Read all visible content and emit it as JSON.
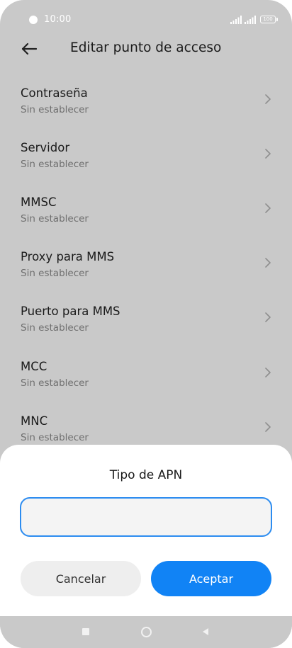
{
  "status_bar": {
    "time": "10:00",
    "battery": "100"
  },
  "header": {
    "back_icon": "arrow-left-icon",
    "title": "Editar punto de acceso"
  },
  "settings": [
    {
      "label": "Contraseña",
      "value": "Sin establecer"
    },
    {
      "label": "Servidor",
      "value": "Sin establecer"
    },
    {
      "label": "MMSC",
      "value": "Sin establecer"
    },
    {
      "label": "Proxy para MMS",
      "value": "Sin establecer"
    },
    {
      "label": "Puerto para MMS",
      "value": "Sin establecer"
    },
    {
      "label": "MCC",
      "value": "Sin establecer"
    },
    {
      "label": "MNC",
      "value": "Sin establecer"
    }
  ],
  "dialog": {
    "title": "Tipo de APN",
    "input_value": "",
    "cancel_label": "Cancelar",
    "accept_label": "Aceptar"
  },
  "colors": {
    "accent": "#1183f5",
    "input_border": "#2c8cf0",
    "dim_background": "#c9c9c9"
  }
}
